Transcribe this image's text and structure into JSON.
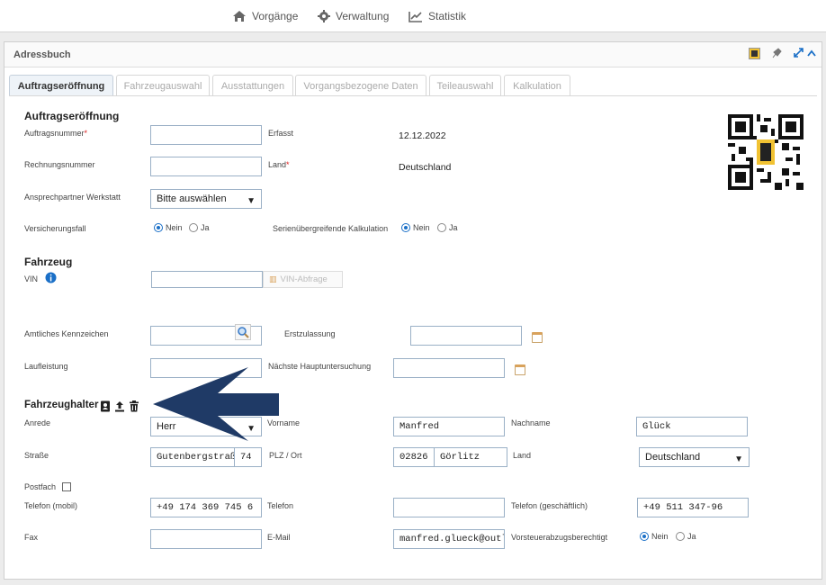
{
  "nav": {
    "items": [
      {
        "label": "Vorgänge",
        "icon": "home-icon"
      },
      {
        "label": "Verwaltung",
        "icon": "gear-icon"
      },
      {
        "label": "Statistik",
        "icon": "line-chart-icon"
      }
    ]
  },
  "panel": {
    "title": "Adressbuch",
    "header_icons": [
      "dat-logo-icon",
      "pin-icon",
      "expand-icon",
      "chevron-up-icon"
    ]
  },
  "tabs": [
    {
      "label": "Auftragseröffnung",
      "active": true
    },
    {
      "label": "Fahrzeugauswahl",
      "active": false
    },
    {
      "label": "Ausstattungen",
      "active": false
    },
    {
      "label": "Vorgangsbezogene Daten",
      "active": false
    },
    {
      "label": "Teileauswahl",
      "active": false
    },
    {
      "label": "Kalkulation",
      "active": false
    }
  ],
  "order": {
    "heading": "Auftragseröffnung",
    "order_number_label": "Auftragsnummer",
    "order_number_value": "",
    "captured_label": "Erfasst",
    "captured_value": "12.12.2022",
    "invoice_number_label": "Rechnungsnummer",
    "invoice_number_value": "",
    "country_label": "Land",
    "country_value": "Deutschland",
    "contact_label": "Ansprechpartner Werkstatt",
    "contact_value": "Bitte auswählen",
    "insurance_label": "Versicherungsfall",
    "insurance_options": [
      "Nein",
      "Ja"
    ],
    "insurance_selected": "Nein",
    "serial_label": "Serienübergreifende Kalkulation",
    "serial_options": [
      "Nein",
      "Ja"
    ],
    "serial_selected": "Nein",
    "required_mark": "*"
  },
  "vehicle": {
    "heading": "Fahrzeug",
    "vin_label": "VIN",
    "vin_value": "",
    "vin_button": "VIN-Abfrage",
    "plate_label": "Amtliches Kennzeichen",
    "plate_value": "",
    "first_reg_label": "Erstzulassung",
    "first_reg_value": "",
    "mileage_label": "Laufleistung",
    "mileage_value": "",
    "next_inspection_label": "Nächste Hauptuntersuchung",
    "next_inspection_value": ""
  },
  "owner": {
    "heading": "Fahrzeughalter",
    "salutation_label": "Anrede",
    "salutation_value": "Herr",
    "firstname_label": "Vorname",
    "firstname_value": "Manfred",
    "lastname_label": "Nachname",
    "lastname_value": "Glück",
    "street_label": "Straße",
    "street_value": "Gutenbergstraße",
    "house_number_value": "74",
    "zip_city_label": "PLZ / Ort",
    "zip_value": "02826",
    "city_value": "Görlitz",
    "country_label": "Land",
    "country_value": "Deutschland",
    "pobox_label": "Postfach",
    "mobile_label": "Telefon (mobil)",
    "mobile_value": "+49 174 369 745 6",
    "phone_label": "Telefon",
    "phone_value": "",
    "business_phone_label": "Telefon (geschäftlich)",
    "business_phone_value": "+49 511 347-96",
    "fax_label": "Fax",
    "fax_value": "",
    "email_label": "E-Mail",
    "email_value": "manfred.glueck@outloo",
    "vat_label": "Vorsteuerabzugsberechtigt",
    "vat_options": [
      "Nein",
      "Ja"
    ],
    "vat_selected": "Nein"
  },
  "colors": {
    "accent": "#1a6fc7",
    "arrow": "#1f3a66",
    "required": "#e02020",
    "input_border": "#9ab0c6"
  }
}
